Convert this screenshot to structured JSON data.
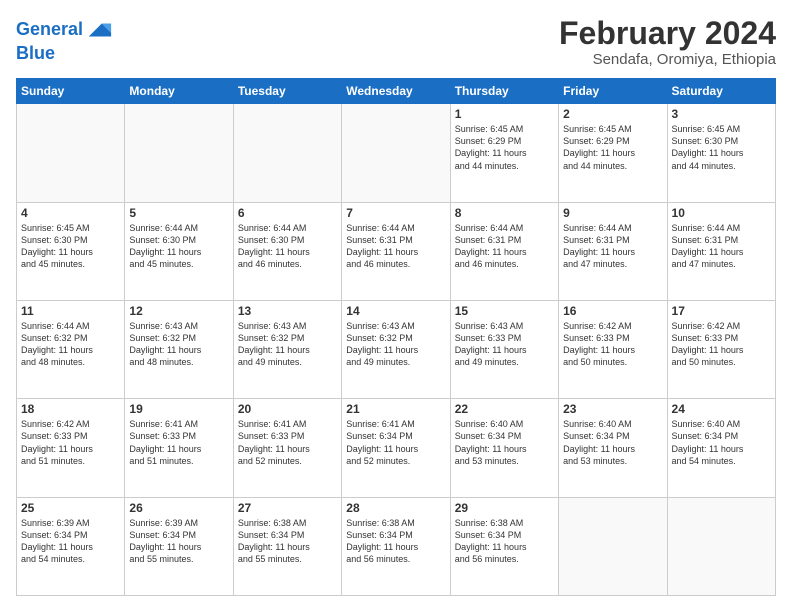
{
  "header": {
    "logo_line1": "General",
    "logo_line2": "Blue",
    "main_title": "February 2024",
    "subtitle": "Sendafa, Oromiya, Ethiopia"
  },
  "weekdays": [
    "Sunday",
    "Monday",
    "Tuesday",
    "Wednesday",
    "Thursday",
    "Friday",
    "Saturday"
  ],
  "weeks": [
    [
      {
        "day": "",
        "info": ""
      },
      {
        "day": "",
        "info": ""
      },
      {
        "day": "",
        "info": ""
      },
      {
        "day": "",
        "info": ""
      },
      {
        "day": "1",
        "info": "Sunrise: 6:45 AM\nSunset: 6:29 PM\nDaylight: 11 hours\nand 44 minutes."
      },
      {
        "day": "2",
        "info": "Sunrise: 6:45 AM\nSunset: 6:29 PM\nDaylight: 11 hours\nand 44 minutes."
      },
      {
        "day": "3",
        "info": "Sunrise: 6:45 AM\nSunset: 6:30 PM\nDaylight: 11 hours\nand 44 minutes."
      }
    ],
    [
      {
        "day": "4",
        "info": "Sunrise: 6:45 AM\nSunset: 6:30 PM\nDaylight: 11 hours\nand 45 minutes."
      },
      {
        "day": "5",
        "info": "Sunrise: 6:44 AM\nSunset: 6:30 PM\nDaylight: 11 hours\nand 45 minutes."
      },
      {
        "day": "6",
        "info": "Sunrise: 6:44 AM\nSunset: 6:30 PM\nDaylight: 11 hours\nand 46 minutes."
      },
      {
        "day": "7",
        "info": "Sunrise: 6:44 AM\nSunset: 6:31 PM\nDaylight: 11 hours\nand 46 minutes."
      },
      {
        "day": "8",
        "info": "Sunrise: 6:44 AM\nSunset: 6:31 PM\nDaylight: 11 hours\nand 46 minutes."
      },
      {
        "day": "9",
        "info": "Sunrise: 6:44 AM\nSunset: 6:31 PM\nDaylight: 11 hours\nand 47 minutes."
      },
      {
        "day": "10",
        "info": "Sunrise: 6:44 AM\nSunset: 6:31 PM\nDaylight: 11 hours\nand 47 minutes."
      }
    ],
    [
      {
        "day": "11",
        "info": "Sunrise: 6:44 AM\nSunset: 6:32 PM\nDaylight: 11 hours\nand 48 minutes."
      },
      {
        "day": "12",
        "info": "Sunrise: 6:43 AM\nSunset: 6:32 PM\nDaylight: 11 hours\nand 48 minutes."
      },
      {
        "day": "13",
        "info": "Sunrise: 6:43 AM\nSunset: 6:32 PM\nDaylight: 11 hours\nand 49 minutes."
      },
      {
        "day": "14",
        "info": "Sunrise: 6:43 AM\nSunset: 6:32 PM\nDaylight: 11 hours\nand 49 minutes."
      },
      {
        "day": "15",
        "info": "Sunrise: 6:43 AM\nSunset: 6:33 PM\nDaylight: 11 hours\nand 49 minutes."
      },
      {
        "day": "16",
        "info": "Sunrise: 6:42 AM\nSunset: 6:33 PM\nDaylight: 11 hours\nand 50 minutes."
      },
      {
        "day": "17",
        "info": "Sunrise: 6:42 AM\nSunset: 6:33 PM\nDaylight: 11 hours\nand 50 minutes."
      }
    ],
    [
      {
        "day": "18",
        "info": "Sunrise: 6:42 AM\nSunset: 6:33 PM\nDaylight: 11 hours\nand 51 minutes."
      },
      {
        "day": "19",
        "info": "Sunrise: 6:41 AM\nSunset: 6:33 PM\nDaylight: 11 hours\nand 51 minutes."
      },
      {
        "day": "20",
        "info": "Sunrise: 6:41 AM\nSunset: 6:33 PM\nDaylight: 11 hours\nand 52 minutes."
      },
      {
        "day": "21",
        "info": "Sunrise: 6:41 AM\nSunset: 6:34 PM\nDaylight: 11 hours\nand 52 minutes."
      },
      {
        "day": "22",
        "info": "Sunrise: 6:40 AM\nSunset: 6:34 PM\nDaylight: 11 hours\nand 53 minutes."
      },
      {
        "day": "23",
        "info": "Sunrise: 6:40 AM\nSunset: 6:34 PM\nDaylight: 11 hours\nand 53 minutes."
      },
      {
        "day": "24",
        "info": "Sunrise: 6:40 AM\nSunset: 6:34 PM\nDaylight: 11 hours\nand 54 minutes."
      }
    ],
    [
      {
        "day": "25",
        "info": "Sunrise: 6:39 AM\nSunset: 6:34 PM\nDaylight: 11 hours\nand 54 minutes."
      },
      {
        "day": "26",
        "info": "Sunrise: 6:39 AM\nSunset: 6:34 PM\nDaylight: 11 hours\nand 55 minutes."
      },
      {
        "day": "27",
        "info": "Sunrise: 6:38 AM\nSunset: 6:34 PM\nDaylight: 11 hours\nand 55 minutes."
      },
      {
        "day": "28",
        "info": "Sunrise: 6:38 AM\nSunset: 6:34 PM\nDaylight: 11 hours\nand 56 minutes."
      },
      {
        "day": "29",
        "info": "Sunrise: 6:38 AM\nSunset: 6:34 PM\nDaylight: 11 hours\nand 56 minutes."
      },
      {
        "day": "",
        "info": ""
      },
      {
        "day": "",
        "info": ""
      }
    ]
  ]
}
